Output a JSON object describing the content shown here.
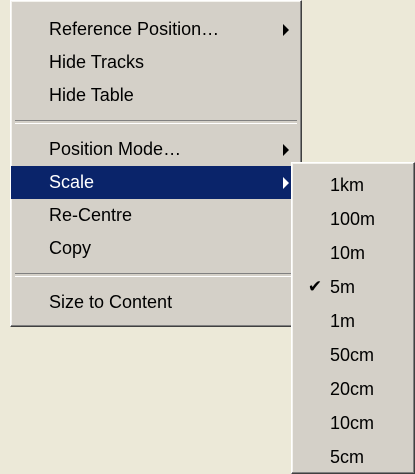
{
  "context_menu": {
    "items": [
      {
        "label": "Reference Position…"
      },
      {
        "label": "Hide Tracks"
      },
      {
        "label": "Hide Table"
      },
      {
        "label": "Position Mode…"
      },
      {
        "label": "Scale"
      },
      {
        "label": "Re-Centre"
      },
      {
        "label": "Copy"
      },
      {
        "label": "Size to Content"
      }
    ],
    "selected_item": "Scale"
  },
  "scale_submenu": {
    "items": [
      {
        "label": "1km"
      },
      {
        "label": "100m"
      },
      {
        "label": "10m"
      },
      {
        "label": "5m"
      },
      {
        "label": "1m"
      },
      {
        "label": "50cm"
      },
      {
        "label": "20cm"
      },
      {
        "label": "10cm"
      },
      {
        "label": "5cm"
      }
    ],
    "checked_item": "5m",
    "check_icon": "✔"
  },
  "colors": {
    "menu_background": "#d4d0c8",
    "selection_background": "#0a246a",
    "selection_text": "#ffffff",
    "desktop_background": "#ece9d8"
  }
}
